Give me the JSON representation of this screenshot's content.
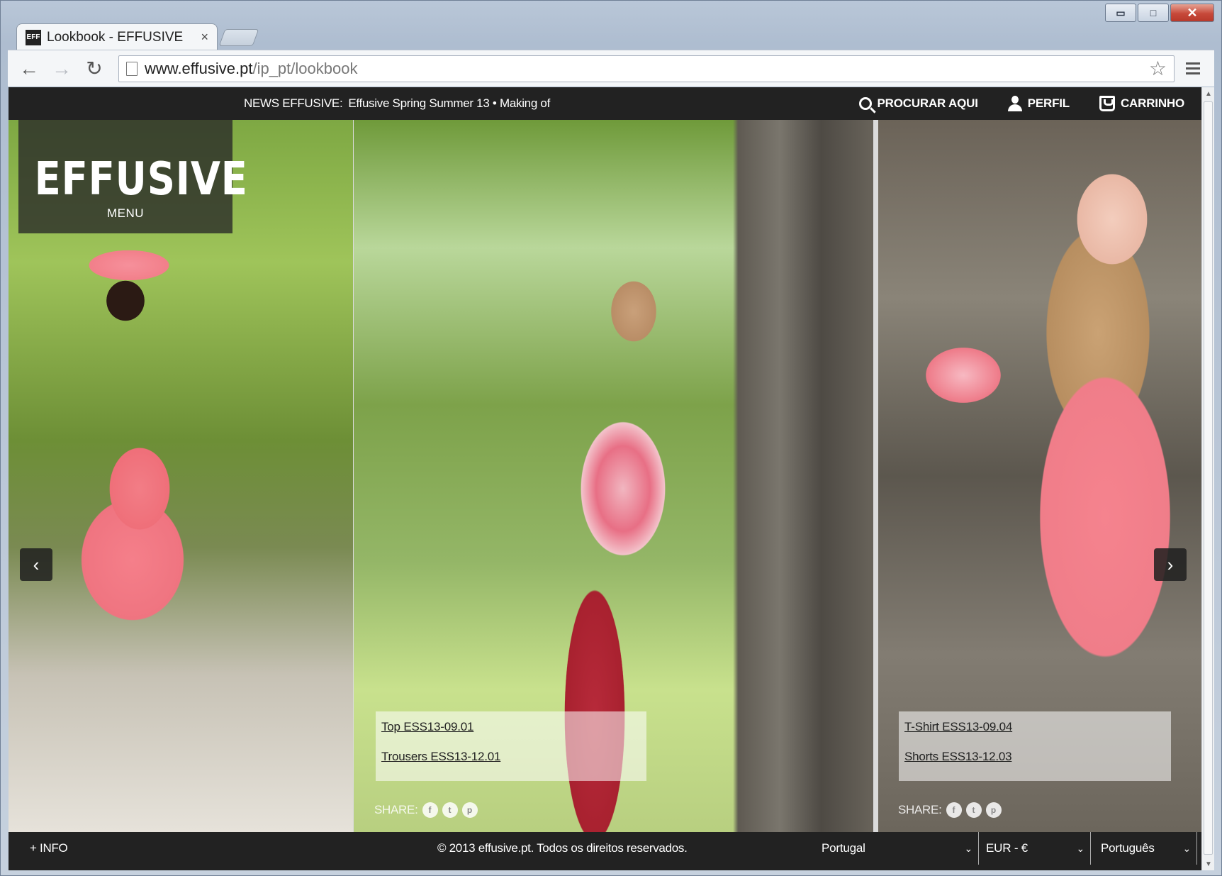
{
  "window": {
    "min_symbol": "▭",
    "max_symbol": "□",
    "close_symbol": "✕"
  },
  "tab": {
    "favicon_text": "EFF",
    "title": "Lookbook - EFFUSIVE",
    "close_symbol": "×"
  },
  "toolbar": {
    "back_icon": "←",
    "forward_icon": "→",
    "reload_icon": "↻",
    "url_host": "www.effusive.pt",
    "url_path": "/ip_pt/lookbook",
    "star_icon": "☆"
  },
  "topbar": {
    "news_label": "NEWS EFFUSIVE:",
    "news_items": "Effusive Spring Summer 13 • Making of",
    "search": "PROCURAR AQUI",
    "profile": "PERFIL",
    "cart": "CARRINHO"
  },
  "logo": {
    "text": "EFFUSIVE",
    "menu": "MENU"
  },
  "carousel": {
    "prev_icon": "‹",
    "next_icon": "›"
  },
  "products": [
    {
      "top": "Top ESS13-09.01",
      "bottom": "Trousers ESS13-12.01"
    },
    {
      "top": "T-Shirt ESS13-09.04",
      "bottom": "Shorts ESS13-12.03"
    }
  ],
  "share": {
    "label": "SHARE:",
    "icons": [
      "f",
      "t",
      "p"
    ]
  },
  "footer": {
    "info": "+ INFO",
    "copyright": "© 2013 effusive.pt. Todos os direitos reservados.",
    "country": "Portugal",
    "currency": "EUR - €",
    "language": "Português",
    "chevron": "⌄"
  },
  "icons": {
    "search": "search-icon",
    "profile": "user-icon",
    "cart": "cart-icon",
    "page": "page-icon"
  }
}
